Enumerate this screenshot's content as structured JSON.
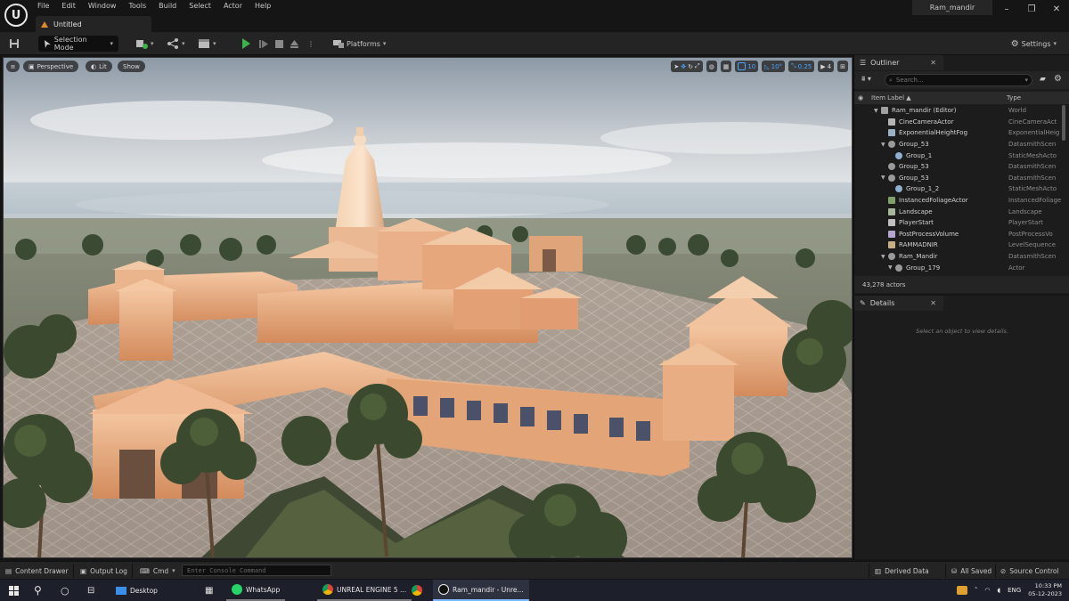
{
  "menu": {
    "items": [
      "File",
      "Edit",
      "Window",
      "Tools",
      "Build",
      "Select",
      "Actor",
      "Help"
    ],
    "project_name": "Ram_mandir"
  },
  "tabs": {
    "doc_tab": "Untitled"
  },
  "toolbar": {
    "selection_mode": "Selection Mode",
    "platforms": "Platforms",
    "settings": "Settings"
  },
  "viewport": {
    "perspective": "Perspective",
    "lit": "Lit",
    "show": "Show",
    "grid_snap": "10",
    "rotation_snap": "10°",
    "scale_snap": "0.25",
    "camera_speed": "4"
  },
  "outliner": {
    "title": "Outliner",
    "search_placeholder": "Search...",
    "col_label": "Item Label ▲",
    "col_type": "Type",
    "rows": [
      {
        "label": "Ram_mandir (Editor)",
        "type": "World",
        "indent": 0,
        "arrow": "▼",
        "icon": "world"
      },
      {
        "label": "CineCameraActor",
        "type": "CineCameraAct",
        "indent": 1,
        "arrow": "",
        "icon": "camera"
      },
      {
        "label": "ExponentialHeightFog",
        "type": "ExponentialHeig",
        "indent": 1,
        "arrow": "",
        "icon": "fog"
      },
      {
        "label": "Group_53",
        "type": "DatasmithScen",
        "indent": 1,
        "arrow": "▼",
        "icon": "group"
      },
      {
        "label": "Group_1",
        "type": "StaticMeshActo",
        "indent": 2,
        "arrow": "",
        "icon": "mesh"
      },
      {
        "label": "Group_53",
        "type": "DatasmithScen",
        "indent": 1,
        "arrow": "",
        "icon": "group"
      },
      {
        "label": "Group_53",
        "type": "DatasmithScen",
        "indent": 1,
        "arrow": "▼",
        "icon": "group"
      },
      {
        "label": "Group_1_2",
        "type": "StaticMeshActo",
        "indent": 2,
        "arrow": "",
        "icon": "mesh"
      },
      {
        "label": "InstancedFoliageActor",
        "type": "InstancedFoliage",
        "indent": 1,
        "arrow": "",
        "icon": "foliage"
      },
      {
        "label": "Landscape",
        "type": "Landscape",
        "indent": 1,
        "arrow": "",
        "icon": "landscape"
      },
      {
        "label": "PlayerStart",
        "type": "PlayerStart",
        "indent": 1,
        "arrow": "",
        "icon": "player"
      },
      {
        "label": "PostProcessVolume",
        "type": "PostProcessVo",
        "indent": 1,
        "arrow": "",
        "icon": "volume"
      },
      {
        "label": "RAMMADNIR",
        "type": "LevelSequence",
        "indent": 1,
        "arrow": "",
        "icon": "sequence"
      },
      {
        "label": "Ram_Mandir",
        "type": "DatasmithScen",
        "indent": 1,
        "arrow": "▼",
        "icon": "group"
      },
      {
        "label": "Group_179",
        "type": "Actor",
        "indent": 2,
        "arrow": "▼",
        "icon": "group"
      }
    ],
    "actor_count": "43,278 actors"
  },
  "details": {
    "title": "Details",
    "hint": "Select an object to view details."
  },
  "statusbar": {
    "content_drawer": "Content Drawer",
    "output_log": "Output Log",
    "cmd": "Cmd",
    "console_placeholder": "Enter Console Command",
    "derived_data": "Derived Data",
    "all_saved": "All Saved",
    "source_control": "Source Control"
  },
  "taskbar": {
    "desktop": "Desktop",
    "whatsapp": "WhatsApp",
    "chrome_tab": "UNREAL ENGINE 5 ...",
    "unreal": "Ram_mandir - Unre...",
    "lang": "ENG",
    "time": "10:33 PM",
    "date": "05-12-2023"
  },
  "colors": {
    "accent_blue": "#4aa3ff",
    "play_green": "#39b54a",
    "panel_bg": "#1c1c1c",
    "toolbar_bg": "#242424"
  }
}
